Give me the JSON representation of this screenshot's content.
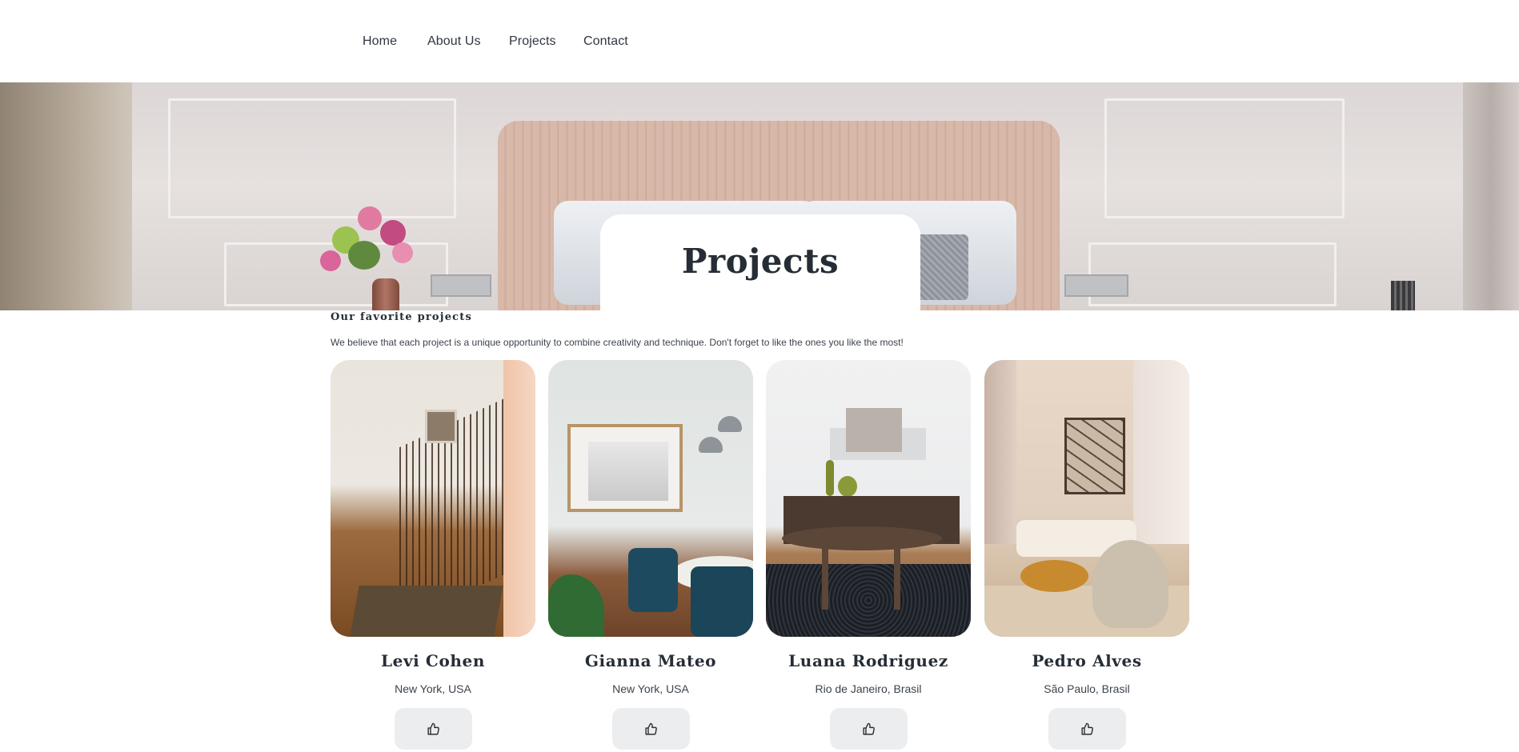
{
  "nav": {
    "items": [
      "Home",
      "About Us",
      "Projects",
      "Contact"
    ]
  },
  "hero": {
    "title": "Projects"
  },
  "section": {
    "title": "Our favorite projects",
    "description": "We believe that each project is a unique opportunity to combine creativity and technique. Don't forget to like the ones you like the most!"
  },
  "projects": [
    {
      "name": "Levi Cohen",
      "location": "New York, USA"
    },
    {
      "name": "Gianna Mateo",
      "location": "New York, USA"
    },
    {
      "name": "Luana Rodriguez",
      "location": "Rio de Janeiro, Brasil"
    },
    {
      "name": "Pedro Alves",
      "location": "São Paulo, Brasil"
    }
  ],
  "icons": {
    "like": "thumbs-up-icon"
  }
}
